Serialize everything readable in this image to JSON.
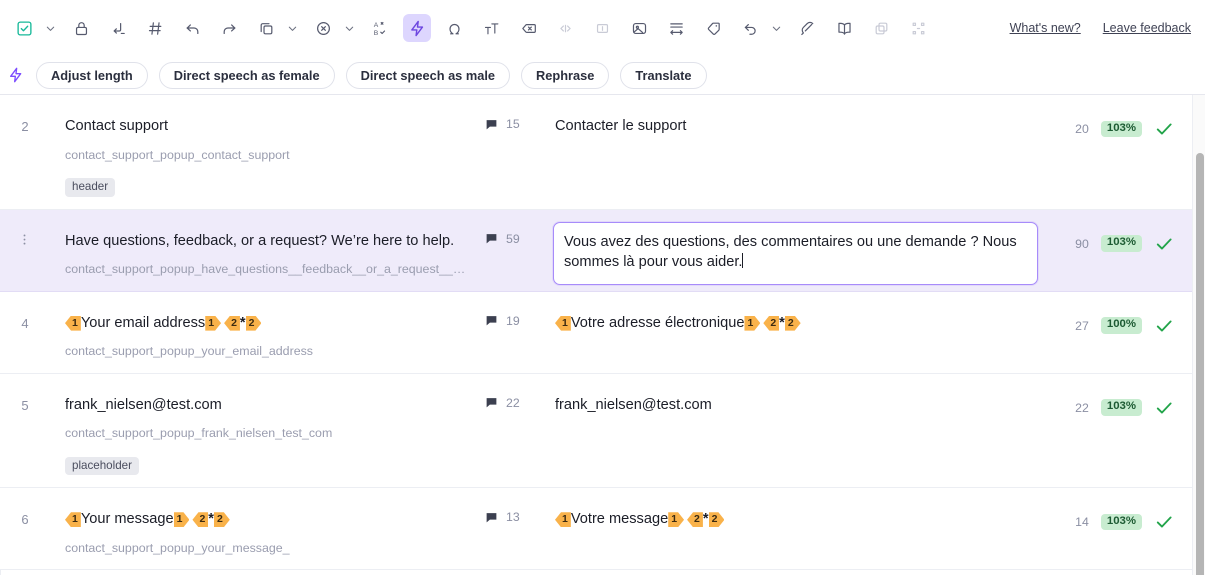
{
  "toolbar": {
    "left_icons": [
      {
        "name": "confirm-segment-icon",
        "glyph": "check-square",
        "state": "normal",
        "accent": "#17b999"
      },
      {
        "name": "confirm-dropdown-caret",
        "glyph": "caret",
        "state": "normal"
      },
      {
        "name": "lock-segment-icon",
        "glyph": "lock",
        "state": "normal"
      },
      {
        "name": "insert-source-icon",
        "glyph": "insert-source",
        "state": "normal"
      },
      {
        "name": "segment-number-icon",
        "glyph": "hash",
        "state": "normal"
      },
      {
        "name": "undo-icon",
        "glyph": "undo-arrow",
        "state": "normal"
      },
      {
        "name": "redo-icon",
        "glyph": "redo-arrow",
        "state": "normal"
      },
      {
        "name": "copy-icon",
        "glyph": "copy",
        "state": "normal"
      },
      {
        "name": "copy-dropdown-caret",
        "glyph": "caret",
        "state": "normal"
      },
      {
        "name": "clear-target-icon",
        "glyph": "circle-x",
        "state": "normal"
      },
      {
        "name": "clear-dropdown-caret",
        "glyph": "caret",
        "state": "normal"
      },
      {
        "name": "spellcheck-icon",
        "glyph": "ab-check",
        "state": "normal"
      },
      {
        "name": "ai-assist-icon",
        "glyph": "bolt",
        "state": "active"
      },
      {
        "name": "special-character-icon",
        "glyph": "omega",
        "state": "normal"
      },
      {
        "name": "change-case-icon",
        "glyph": "t-case",
        "state": "normal"
      },
      {
        "name": "remove-tag-icon",
        "glyph": "tag-delete",
        "state": "normal"
      },
      {
        "name": "show-tags-icon",
        "glyph": "angle-brackets",
        "state": "disabled"
      },
      {
        "name": "non-breaking-space-icon",
        "glyph": "boxed-bar",
        "state": "disabled"
      },
      {
        "name": "insert-image-icon",
        "glyph": "image",
        "state": "normal"
      },
      {
        "name": "adjust-width-icon",
        "glyph": "adjust-width",
        "state": "normal"
      },
      {
        "name": "label-icon",
        "glyph": "price-tag",
        "state": "normal"
      },
      {
        "name": "revert-icon",
        "glyph": "revert-arrow",
        "state": "normal"
      },
      {
        "name": "revert-dropdown-caret",
        "glyph": "caret",
        "state": "normal"
      },
      {
        "name": "comment-feather-icon",
        "glyph": "feather",
        "state": "normal"
      },
      {
        "name": "glossary-icon",
        "glyph": "book",
        "state": "normal"
      },
      {
        "name": "duplicate-icon",
        "glyph": "duplicate",
        "state": "disabled"
      },
      {
        "name": "split-merge-icon",
        "glyph": "split-merge",
        "state": "disabled"
      }
    ],
    "whats_new_label": "What's new?",
    "leave_feedback_label": "Leave feedback"
  },
  "ai_chips": {
    "bolt_icon": "bolt-icon",
    "items": [
      {
        "label": "Adjust length"
      },
      {
        "label": "Direct speech as female"
      },
      {
        "label": "Direct speech as male"
      },
      {
        "label": "Rephrase"
      },
      {
        "label": "Translate"
      }
    ]
  },
  "grid": {
    "rows": [
      {
        "num": "2",
        "source_parts": [
          {
            "t": "text",
            "v": "Contact support"
          }
        ],
        "key": "contact_support_popup_contact_support",
        "flag_count": "15",
        "target_parts": [
          {
            "t": "text",
            "v": "Contacter le support"
          }
        ],
        "target_count": "20",
        "pct": "103%",
        "selected": false,
        "editing": false,
        "tag_label": "header"
      },
      {
        "num": "",
        "source_parts": [
          {
            "t": "text",
            "v": "Have questions, feedback, or a request? We’re here to help."
          }
        ],
        "key": "contact_support_popup_have_questions__feedback__or_a_request__we_...",
        "flag_count": "59",
        "target_parts": [
          {
            "t": "text",
            "v": "Vous avez des questions, des commentaires ou une demande ? Nous sommes là pour vous aider."
          }
        ],
        "target_count": "90",
        "pct": "103%",
        "selected": true,
        "editing": true,
        "tag_label": ""
      },
      {
        "num": "4",
        "source_parts": [
          {
            "t": "ph-open",
            "v": "1"
          },
          {
            "t": "text",
            "v": "Your email address"
          },
          {
            "t": "ph-close",
            "v": "1"
          },
          {
            "t": "gap",
            "v": ""
          },
          {
            "t": "ph-open",
            "v": "2"
          },
          {
            "t": "star",
            "v": "*"
          },
          {
            "t": "ph-close",
            "v": "2"
          }
        ],
        "key": "contact_support_popup_your_email_address",
        "flag_count": "19",
        "target_parts": [
          {
            "t": "ph-open",
            "v": "1"
          },
          {
            "t": "text",
            "v": "Votre adresse électronique"
          },
          {
            "t": "ph-close",
            "v": "1"
          },
          {
            "t": "gap",
            "v": ""
          },
          {
            "t": "ph-open",
            "v": "2"
          },
          {
            "t": "star",
            "v": "*"
          },
          {
            "t": "ph-close",
            "v": "2"
          }
        ],
        "target_count": "27",
        "pct": "100%",
        "selected": false,
        "editing": false,
        "tag_label": ""
      },
      {
        "num": "5",
        "source_parts": [
          {
            "t": "text",
            "v": "frank_nielsen@test.com"
          }
        ],
        "key": "contact_support_popup_frank_nielsen_test_com",
        "flag_count": "22",
        "target_parts": [
          {
            "t": "text",
            "v": "frank_nielsen@test.com"
          }
        ],
        "target_count": "22",
        "pct": "103%",
        "selected": false,
        "editing": false,
        "tag_label": "placeholder"
      },
      {
        "num": "6",
        "source_parts": [
          {
            "t": "ph-open",
            "v": "1"
          },
          {
            "t": "text",
            "v": "Your message"
          },
          {
            "t": "ph-close",
            "v": "1"
          },
          {
            "t": "gap",
            "v": ""
          },
          {
            "t": "ph-open",
            "v": "2"
          },
          {
            "t": "star",
            "v": "*"
          },
          {
            "t": "ph-close",
            "v": "2"
          }
        ],
        "key": "contact_support_popup_your_message_",
        "flag_count": "13",
        "target_parts": [
          {
            "t": "ph-open",
            "v": "1"
          },
          {
            "t": "text",
            "v": "Votre message"
          },
          {
            "t": "ph-close",
            "v": "1"
          },
          {
            "t": "gap",
            "v": ""
          },
          {
            "t": "ph-open",
            "v": "2"
          },
          {
            "t": "star",
            "v": "*"
          },
          {
            "t": "ph-close",
            "v": "2"
          }
        ],
        "target_count": "14",
        "pct": "103%",
        "selected": false,
        "editing": false,
        "tag_label": ""
      }
    ]
  },
  "colors": {
    "accent_purple": "#6d47e0",
    "selected_row": "#efebfa",
    "pct_badge_bg": "#c8ecd0",
    "pct_badge_text": "#1d5b33",
    "check_green": "#22a44a",
    "placeholder_orange": "#f9b24a"
  }
}
